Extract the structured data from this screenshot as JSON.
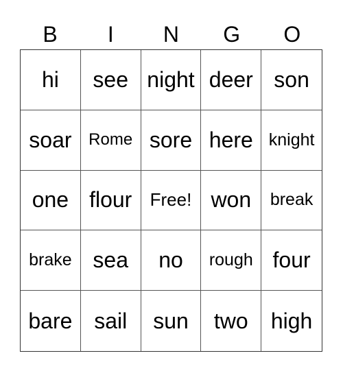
{
  "header": [
    "B",
    "I",
    "N",
    "G",
    "O"
  ],
  "cells": [
    [
      "hi",
      "see",
      "night",
      "deer",
      "son"
    ],
    [
      "soar",
      "Rome",
      "sore",
      "here",
      "knight"
    ],
    [
      "one",
      "flour",
      "Free!",
      "won",
      "break"
    ],
    [
      "brake",
      "sea",
      "no",
      "rough",
      "four"
    ],
    [
      "bare",
      "sail",
      "sun",
      "two",
      "high"
    ]
  ]
}
